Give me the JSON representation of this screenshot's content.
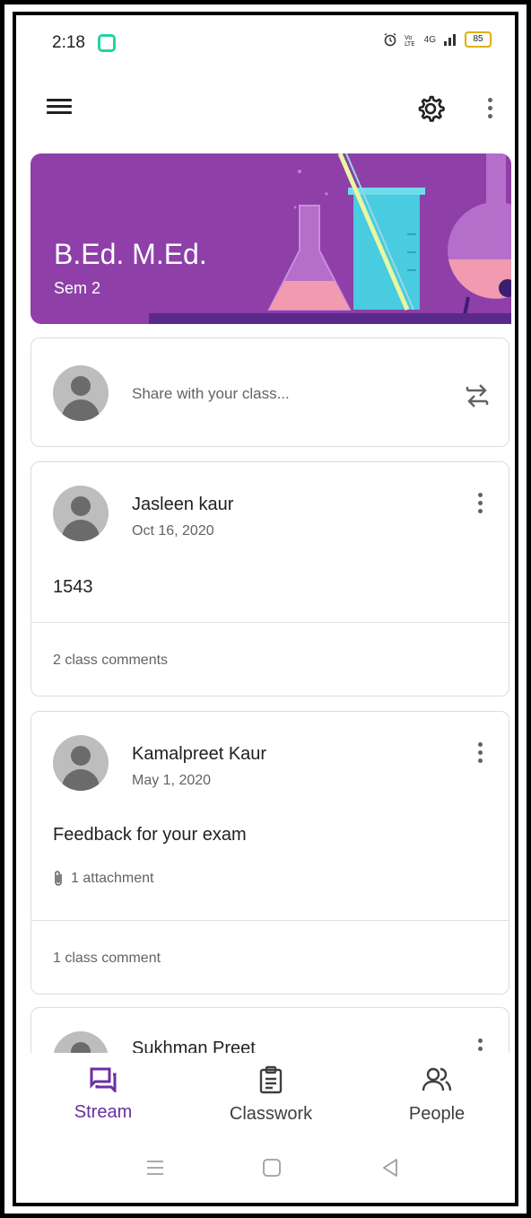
{
  "status_bar": {
    "time": "2:18",
    "network": "4G",
    "battery": "85"
  },
  "banner": {
    "title": "B.Ed. M.Ed.",
    "subtitle": "Sem 2",
    "color": "#8e3fa8"
  },
  "share": {
    "placeholder": "Share with your class..."
  },
  "posts": [
    {
      "author": "Jasleen kaur",
      "date": "Oct 16, 2020",
      "text": "1543",
      "comments": "2 class comments"
    },
    {
      "author": "Kamalpreet Kaur",
      "date": "May 1, 2020",
      "text": "Feedback for your exam",
      "attachment": "1 attachment",
      "comments": "1 class comment"
    },
    {
      "author": "Sukhman Preet"
    }
  ],
  "bottom_nav": {
    "items": [
      {
        "label": "Stream",
        "icon": "stream-icon",
        "active": true
      },
      {
        "label": "Classwork",
        "icon": "classwork-icon",
        "active": false
      },
      {
        "label": "People",
        "icon": "people-icon",
        "active": false
      }
    ],
    "accent": "#6b2fa0"
  }
}
